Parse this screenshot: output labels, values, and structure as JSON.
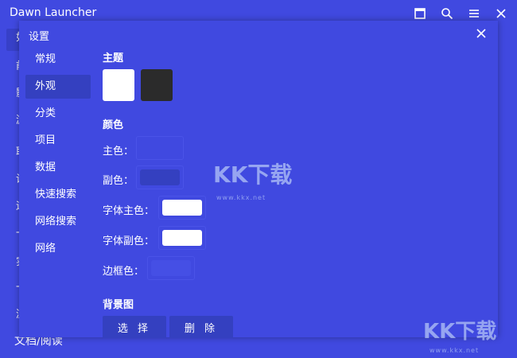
{
  "app": {
    "title": "Dawn Launcher",
    "sidebar_items": [
      "如",
      "前",
      "影",
      "游",
      "取",
      "设",
      "运",
      "一",
      "实",
      "一",
      "浏"
    ],
    "bottom_item": "文档/阅读"
  },
  "dialog": {
    "title": "设置",
    "nav": [
      {
        "label": "常规",
        "active": false
      },
      {
        "label": "外观",
        "active": true
      },
      {
        "label": "分类",
        "active": false
      },
      {
        "label": "项目",
        "active": false
      },
      {
        "label": "数据",
        "active": false
      },
      {
        "label": "快速搜索",
        "active": false
      },
      {
        "label": "网络搜索",
        "active": false
      },
      {
        "label": "网络",
        "active": false
      }
    ],
    "theme": {
      "title": "主题",
      "swatches": [
        "#ffffff",
        "#2b2b2b"
      ]
    },
    "colors": {
      "title": "颜色",
      "rows": [
        {
          "label": "主色：",
          "color": "#4049e0"
        },
        {
          "label": "副色：",
          "color": "#3440c0"
        },
        {
          "label": "字体主色：",
          "color": "#ffffff"
        },
        {
          "label": "字体副色：",
          "color": "#ffffff"
        },
        {
          "label": "边框色：",
          "color": "#4a53e8"
        }
      ]
    },
    "background": {
      "title": "背景图",
      "select_label": "选 择",
      "delete_label": "删 除"
    }
  },
  "watermark": {
    "text": "KK下载",
    "url": "www.kkx.net"
  }
}
